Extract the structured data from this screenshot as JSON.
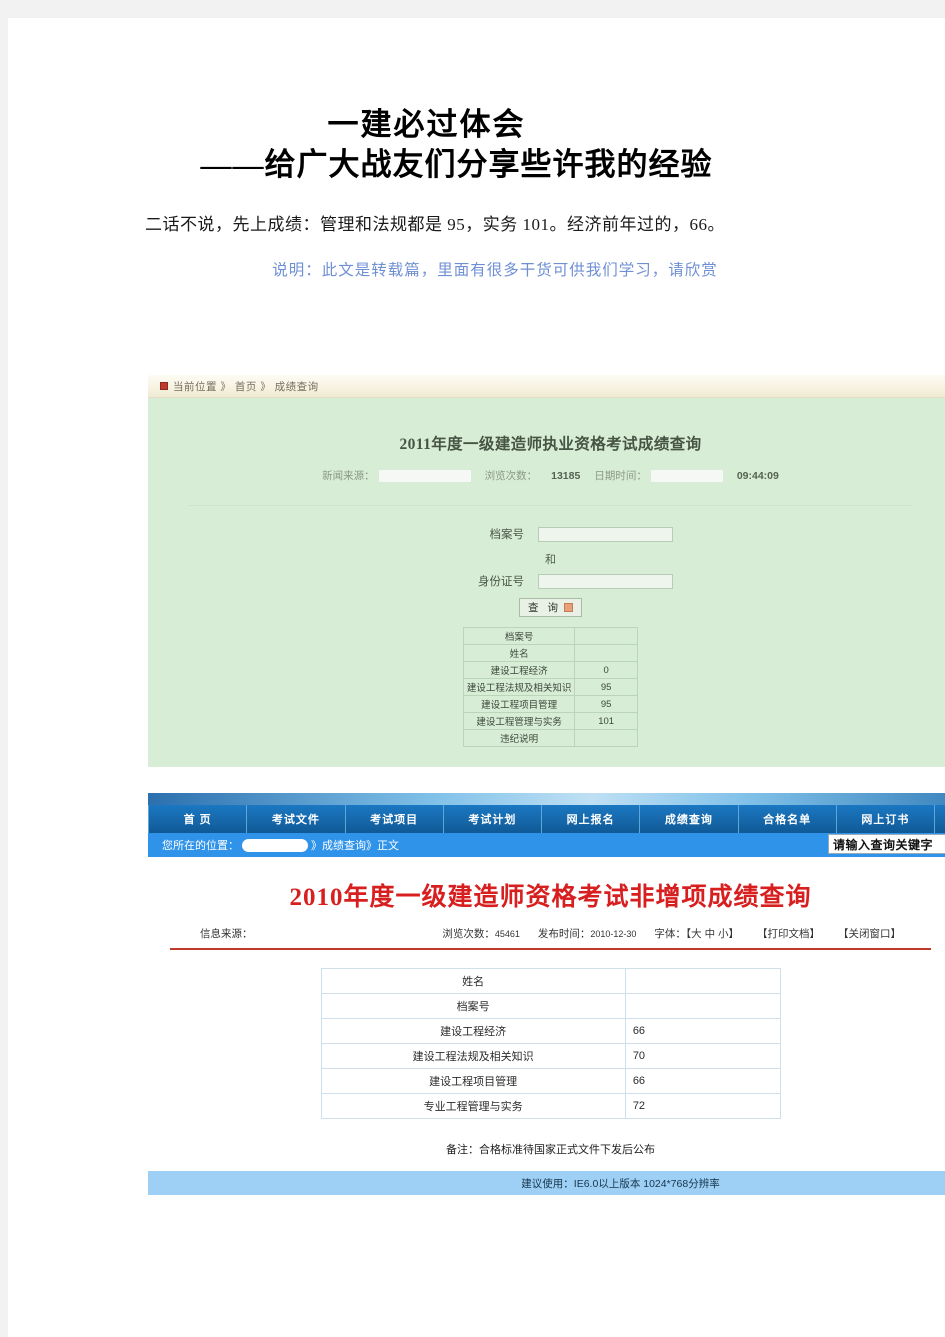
{
  "document": {
    "title": "一建必过体会",
    "subtitle": "——给广大战友们分享些许我的经验",
    "paragraph": "二话不说，先上成绩：管理和法规都是 95，实务 101。经济前年过的，66。",
    "note": "说明：此文是转载篇，里面有很多干货可供我们学习，请欣赏"
  },
  "screenshot1": {
    "breadcrumb": "当前位置 》 首页 》 成绩查询",
    "title": "2011年度一级建造师执业资格考试成绩查询",
    "meta": {
      "source_label": "新闻来源：",
      "views_label": "浏览次数：",
      "views_value": "13185",
      "date_label": "日期时间：",
      "time_value": "09:44:09"
    },
    "form": {
      "field1_label": "档案号",
      "field1_value": "",
      "conjunction": "和",
      "field2_label": "身份证号",
      "field2_value": "",
      "submit_label": "查 询"
    },
    "table": [
      {
        "key": "档案号",
        "value": ""
      },
      {
        "key": "姓名",
        "value": ""
      },
      {
        "key": "建设工程经济",
        "value": "0"
      },
      {
        "key": "建设工程法规及相关知识",
        "value": "95"
      },
      {
        "key": "建设工程项目管理",
        "value": "95"
      },
      {
        "key": "建设工程管理与实务",
        "value": "101"
      },
      {
        "key": "违纪说明",
        "value": ""
      }
    ]
  },
  "screenshot2": {
    "nav": [
      "首 页",
      "考试文件",
      "考试项目",
      "考试计划",
      "网上报名",
      "成绩查询",
      "合格名单",
      "网上订书"
    ],
    "location": "您所在的位置：",
    "location_tail": "》成绩查询》正文",
    "search_placeholder": "请输入查询关键字",
    "title": "2010年度一级建造师资格考试非增项成绩查询",
    "meta": {
      "source_label": "信息来源：",
      "views_label": "浏览次数：",
      "views_value": "45461",
      "publish_label": "发布时间：",
      "publish_value": "2010-12-30",
      "font_label": "字体：【大 中 小】",
      "print_label": "【打印文档】",
      "close_label": "【关闭窗口】"
    },
    "table": [
      {
        "key": "姓名",
        "value": ""
      },
      {
        "key": "档案号",
        "value": ""
      },
      {
        "key": "建设工程经济",
        "value": "66"
      },
      {
        "key": "建设工程法规及相关知识",
        "value": "70"
      },
      {
        "key": "建设工程项目管理",
        "value": "66"
      },
      {
        "key": "专业工程管理与实务",
        "value": "72"
      }
    ],
    "remark": "备注：合格标准待国家正式文件下发后公布",
    "footer": "建议使用：IE6.0以上版本  1024*768分辨率"
  },
  "colors": {
    "blue_note": "#6f8fd4",
    "red_title": "#d81f1f",
    "nav_blue": "#1769ad",
    "loc_blue": "#2f93ea",
    "footer_blue": "#9ed0f5",
    "green_panel": "#d8edd6"
  }
}
